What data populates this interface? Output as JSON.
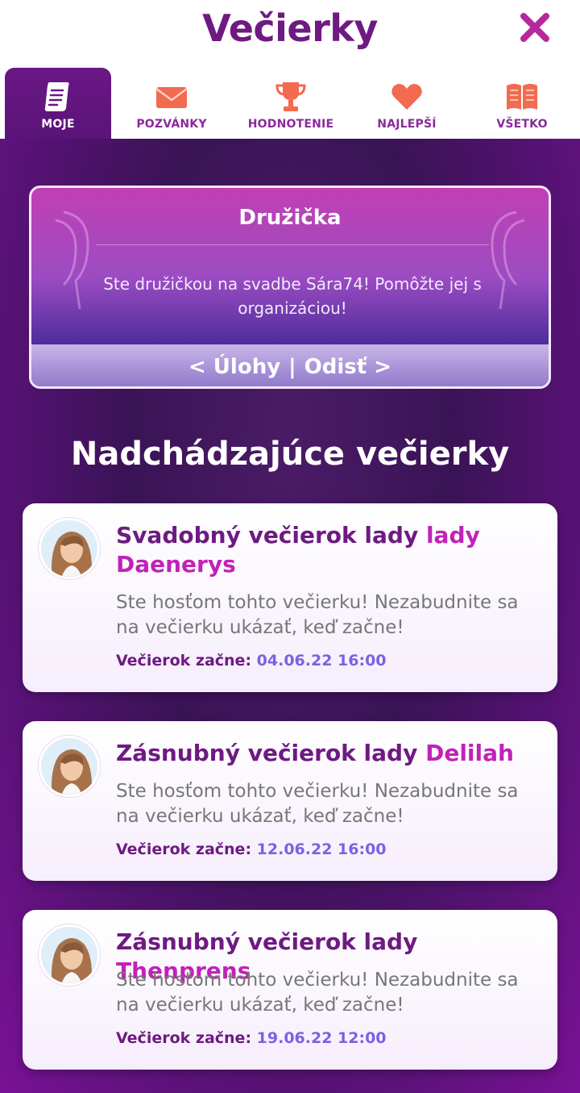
{
  "header": {
    "title": "Večierky"
  },
  "tabs": [
    {
      "label": "MOJE",
      "icon": "scroll-icon",
      "active": true
    },
    {
      "label": "POZVÁNKY",
      "icon": "envelope-icon",
      "active": false
    },
    {
      "label": "HODNOTENIE",
      "icon": "trophy-icon",
      "active": false
    },
    {
      "label": "NAJLEPŠÍ",
      "icon": "heart-icon",
      "active": false
    },
    {
      "label": "VŠETKO",
      "icon": "book-icon",
      "active": false
    }
  ],
  "hero": {
    "title": "Družička",
    "text": "Ste družičkou na svadbe Sára74! Pomôžte jej s organizáciou!",
    "tasks_label": "< Úlohy",
    "separator": "|",
    "leave_label": "Odisť >"
  },
  "upcoming": {
    "title": "Nadchádzajúce večierky",
    "parties": [
      {
        "title_prefix": "Svadobný večierok lady ",
        "title_name": "lady Daenerys",
        "text": "Ste hosťom tohto večierku! Nezabudnite sa na večierku ukázať, keď začne!",
        "date_label": "Večierok začne:",
        "date_value": "04.06.22 16:00"
      },
      {
        "title_prefix": "Zásnubný večierok lady ",
        "title_name": "Delilah",
        "text": "Ste hosťom tohto večierku! Nezabudnite sa na večierku ukázať, keď začne!",
        "date_label": "Večierok začne:",
        "date_value": "12.06.22 16:00"
      },
      {
        "title_prefix": "Zásnubný večierok lady ",
        "title_name": "Thenprens",
        "text": "Ste hosťom tohto večierku! Nezabudnite sa na večierku ukázať, keď začne!",
        "date_label": "Večierok začne:",
        "date_value": "19.06.22 12:00"
      }
    ]
  },
  "colors": {
    "brand_purple": "#6e1a82",
    "highlight_magenta": "#c122b8",
    "date_blue": "#7b62e0",
    "tab_orange": "#f26a4f"
  }
}
